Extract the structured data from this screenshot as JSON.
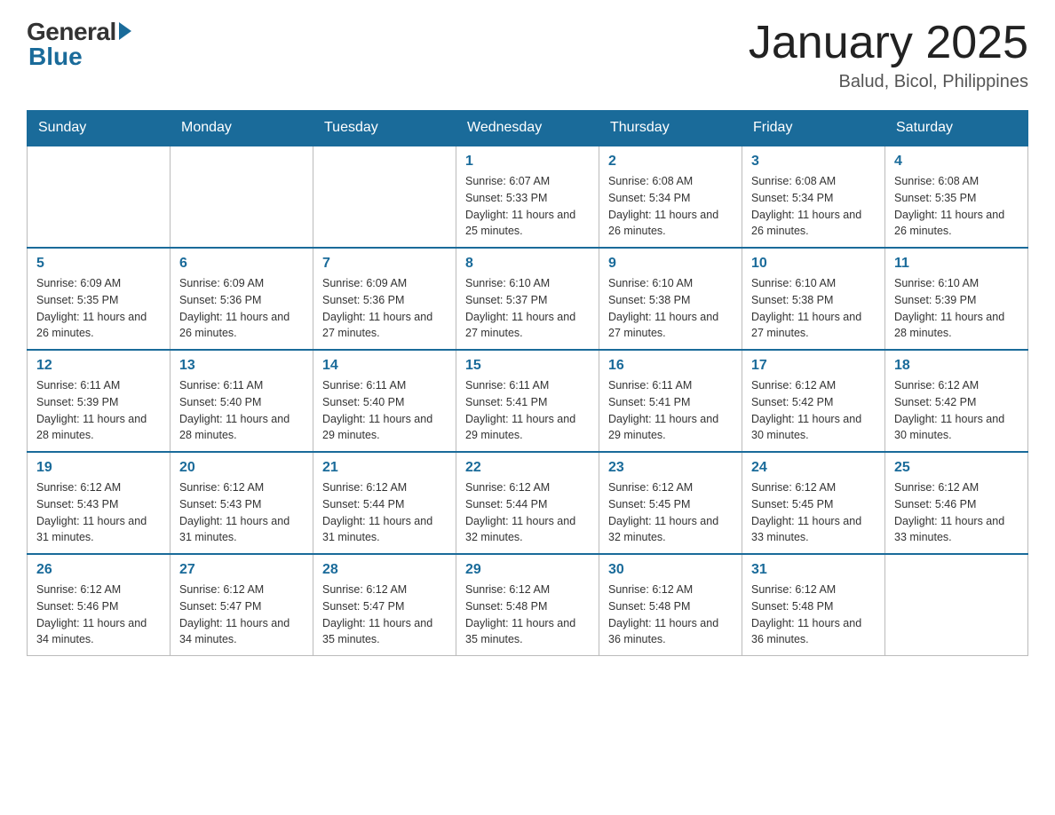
{
  "header": {
    "logo_general": "General",
    "logo_blue": "Blue",
    "month_title": "January 2025",
    "location": "Balud, Bicol, Philippines"
  },
  "weekdays": [
    "Sunday",
    "Monday",
    "Tuesday",
    "Wednesday",
    "Thursday",
    "Friday",
    "Saturday"
  ],
  "weeks": [
    [
      {
        "day": "",
        "info": ""
      },
      {
        "day": "",
        "info": ""
      },
      {
        "day": "",
        "info": ""
      },
      {
        "day": "1",
        "info": "Sunrise: 6:07 AM\nSunset: 5:33 PM\nDaylight: 11 hours and 25 minutes."
      },
      {
        "day": "2",
        "info": "Sunrise: 6:08 AM\nSunset: 5:34 PM\nDaylight: 11 hours and 26 minutes."
      },
      {
        "day": "3",
        "info": "Sunrise: 6:08 AM\nSunset: 5:34 PM\nDaylight: 11 hours and 26 minutes."
      },
      {
        "day": "4",
        "info": "Sunrise: 6:08 AM\nSunset: 5:35 PM\nDaylight: 11 hours and 26 minutes."
      }
    ],
    [
      {
        "day": "5",
        "info": "Sunrise: 6:09 AM\nSunset: 5:35 PM\nDaylight: 11 hours and 26 minutes."
      },
      {
        "day": "6",
        "info": "Sunrise: 6:09 AM\nSunset: 5:36 PM\nDaylight: 11 hours and 26 minutes."
      },
      {
        "day": "7",
        "info": "Sunrise: 6:09 AM\nSunset: 5:36 PM\nDaylight: 11 hours and 27 minutes."
      },
      {
        "day": "8",
        "info": "Sunrise: 6:10 AM\nSunset: 5:37 PM\nDaylight: 11 hours and 27 minutes."
      },
      {
        "day": "9",
        "info": "Sunrise: 6:10 AM\nSunset: 5:38 PM\nDaylight: 11 hours and 27 minutes."
      },
      {
        "day": "10",
        "info": "Sunrise: 6:10 AM\nSunset: 5:38 PM\nDaylight: 11 hours and 27 minutes."
      },
      {
        "day": "11",
        "info": "Sunrise: 6:10 AM\nSunset: 5:39 PM\nDaylight: 11 hours and 28 minutes."
      }
    ],
    [
      {
        "day": "12",
        "info": "Sunrise: 6:11 AM\nSunset: 5:39 PM\nDaylight: 11 hours and 28 minutes."
      },
      {
        "day": "13",
        "info": "Sunrise: 6:11 AM\nSunset: 5:40 PM\nDaylight: 11 hours and 28 minutes."
      },
      {
        "day": "14",
        "info": "Sunrise: 6:11 AM\nSunset: 5:40 PM\nDaylight: 11 hours and 29 minutes."
      },
      {
        "day": "15",
        "info": "Sunrise: 6:11 AM\nSunset: 5:41 PM\nDaylight: 11 hours and 29 minutes."
      },
      {
        "day": "16",
        "info": "Sunrise: 6:11 AM\nSunset: 5:41 PM\nDaylight: 11 hours and 29 minutes."
      },
      {
        "day": "17",
        "info": "Sunrise: 6:12 AM\nSunset: 5:42 PM\nDaylight: 11 hours and 30 minutes."
      },
      {
        "day": "18",
        "info": "Sunrise: 6:12 AM\nSunset: 5:42 PM\nDaylight: 11 hours and 30 minutes."
      }
    ],
    [
      {
        "day": "19",
        "info": "Sunrise: 6:12 AM\nSunset: 5:43 PM\nDaylight: 11 hours and 31 minutes."
      },
      {
        "day": "20",
        "info": "Sunrise: 6:12 AM\nSunset: 5:43 PM\nDaylight: 11 hours and 31 minutes."
      },
      {
        "day": "21",
        "info": "Sunrise: 6:12 AM\nSunset: 5:44 PM\nDaylight: 11 hours and 31 minutes."
      },
      {
        "day": "22",
        "info": "Sunrise: 6:12 AM\nSunset: 5:44 PM\nDaylight: 11 hours and 32 minutes."
      },
      {
        "day": "23",
        "info": "Sunrise: 6:12 AM\nSunset: 5:45 PM\nDaylight: 11 hours and 32 minutes."
      },
      {
        "day": "24",
        "info": "Sunrise: 6:12 AM\nSunset: 5:45 PM\nDaylight: 11 hours and 33 minutes."
      },
      {
        "day": "25",
        "info": "Sunrise: 6:12 AM\nSunset: 5:46 PM\nDaylight: 11 hours and 33 minutes."
      }
    ],
    [
      {
        "day": "26",
        "info": "Sunrise: 6:12 AM\nSunset: 5:46 PM\nDaylight: 11 hours and 34 minutes."
      },
      {
        "day": "27",
        "info": "Sunrise: 6:12 AM\nSunset: 5:47 PM\nDaylight: 11 hours and 34 minutes."
      },
      {
        "day": "28",
        "info": "Sunrise: 6:12 AM\nSunset: 5:47 PM\nDaylight: 11 hours and 35 minutes."
      },
      {
        "day": "29",
        "info": "Sunrise: 6:12 AM\nSunset: 5:48 PM\nDaylight: 11 hours and 35 minutes."
      },
      {
        "day": "30",
        "info": "Sunrise: 6:12 AM\nSunset: 5:48 PM\nDaylight: 11 hours and 36 minutes."
      },
      {
        "day": "31",
        "info": "Sunrise: 6:12 AM\nSunset: 5:48 PM\nDaylight: 11 hours and 36 minutes."
      },
      {
        "day": "",
        "info": ""
      }
    ]
  ]
}
